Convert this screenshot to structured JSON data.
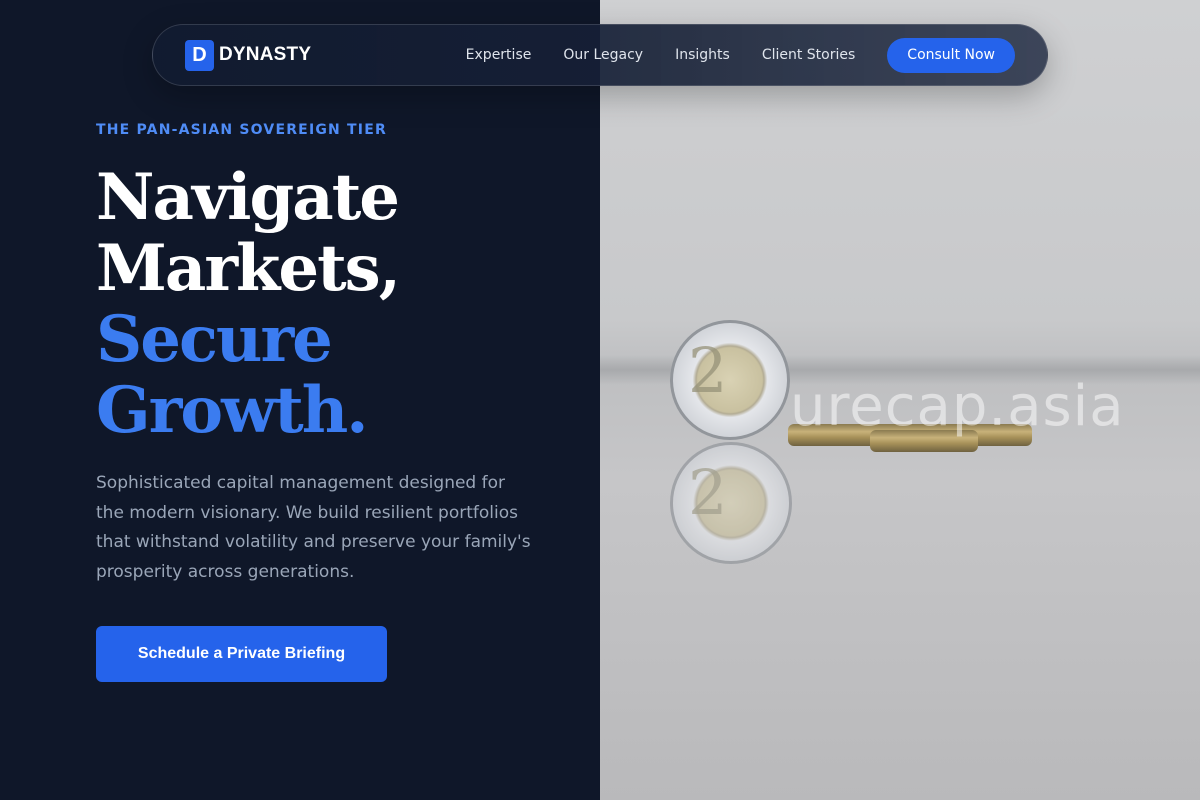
{
  "brand": {
    "mark": "D",
    "name": "DYNASTY"
  },
  "nav": {
    "links": [
      "Expertise",
      "Our Legacy",
      "Insights",
      "Client Stories"
    ],
    "cta_label": "Consult Now"
  },
  "hero": {
    "eyebrow": "THE PAN-ASIAN SOVEREIGN TIER",
    "headline": {
      "line1": "Navigate",
      "line2": "Markets,",
      "line3": "Secure",
      "line4": "Growth."
    },
    "lede": "Sophisticated capital management designed for the modern visionary. We build resilient portfolios that withstand volatility and preserve your family's prosperity across generations.",
    "cta_label": "Schedule a Private Briefing"
  },
  "image": {
    "watermark": "urecap.asia",
    "coin_numeral": "2"
  },
  "colors": {
    "background": "#0f1729",
    "accent": "#2563eb",
    "headline_accent": "#3b7cf0",
    "eyebrow": "#4f8cf6"
  }
}
